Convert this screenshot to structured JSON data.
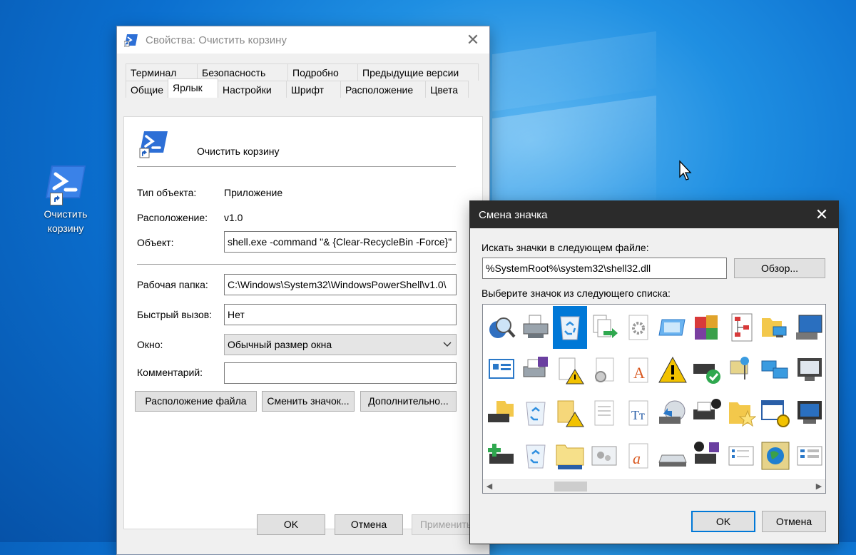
{
  "desktop": {
    "icon_label": "Очистить корзину"
  },
  "properties_dialog": {
    "title": "Свойства: Очистить корзину",
    "tabs_row1": [
      "Терминал",
      "Безопасность",
      "Подробно",
      "Предыдущие версии"
    ],
    "tabs_row2": [
      "Общие",
      "Ярлык",
      "Настройки",
      "Шрифт",
      "Расположение",
      "Цвета"
    ],
    "active_tab": "Ярлык",
    "shortcut_name": "Очистить корзину",
    "labels": {
      "object_type": "Тип объекта:",
      "location": "Расположение:",
      "target": "Объект:",
      "start_in": "Рабочая папка:",
      "hotkey": "Быстрый вызов:",
      "window": "Окно:",
      "comment": "Комментарий:"
    },
    "values": {
      "object_type": "Приложение",
      "location": "v1.0",
      "target": "shell.exe -command \"& {Clear-RecycleBin -Force}\"",
      "start_in": "C:\\Windows\\System32\\WindowsPowerShell\\v1.0\\",
      "hotkey": "Нет",
      "window": "Обычный размер окна",
      "comment": ""
    },
    "buttons": {
      "open_location": "Расположение файла",
      "change_icon": "Сменить значок...",
      "advanced": "Дополнительно...",
      "ok": "OK",
      "cancel": "Отмена",
      "apply": "Применить"
    }
  },
  "change_icon_dialog": {
    "title": "Смена значка",
    "search_label": "Искать значки в следующем файле:",
    "file_path": "%SystemRoot%\\system32\\shell32.dll",
    "browse": "Обзор...",
    "list_label": "Выберите значок из следующего списка:",
    "ok": "OK",
    "cancel": "Отмена",
    "icons": [
      "search-globe-icon",
      "printer-icon",
      "recycle-bin-empty-icon",
      "file-copy-arrow-icon",
      "gear-file-icon",
      "window-icon",
      "app-blocks-icon",
      "flowchart-icon",
      "network-folder-icon",
      "computer-monitor-icon",
      "presentation-icon",
      "printer-disk-icon",
      "file-warning-icon",
      "gear-document-icon",
      "font-a-icon",
      "warning-icon",
      "printer-check-icon",
      "network-pin-icon",
      "network-computers-icon",
      "monitor-icon",
      "printer-folder-icon",
      "recycle-bin-icon",
      "folder-warning-icon",
      "text-document-icon",
      "font-tt-icon",
      "cd-drive-icon",
      "printer-check-dark-icon",
      "folder-star-icon",
      "calendar-gear-icon",
      "monitor-dark-icon",
      "add-printer-icon",
      "recycle-bin-full-icon",
      "folder-network-icon",
      "settings-panel-icon",
      "font-a-orange-icon",
      "drive-icon",
      "printer-check-disk-icon",
      "checklist-icon",
      "globe-frame-icon",
      "list-window-icon"
    ],
    "selected_icon_index": 2
  }
}
